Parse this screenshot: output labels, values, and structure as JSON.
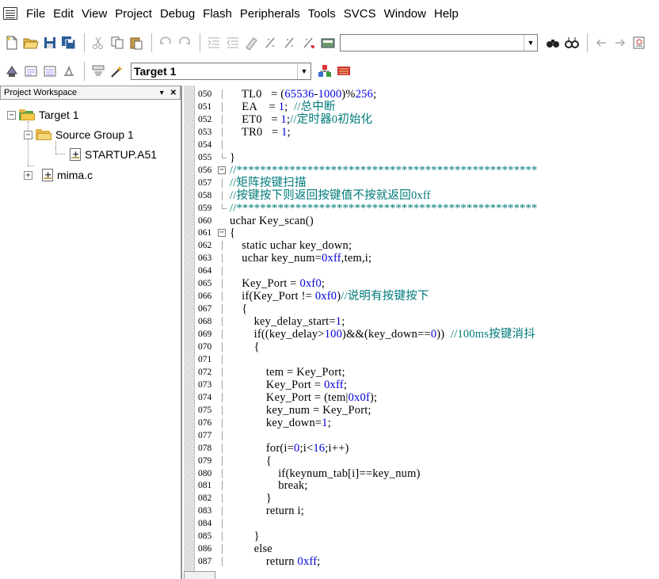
{
  "menu": [
    "File",
    "Edit",
    "View",
    "Project",
    "Debug",
    "Flash",
    "Peripherals",
    "Tools",
    "SVCS",
    "Window",
    "Help"
  ],
  "toolbar2": {
    "target_select": "Target 1"
  },
  "workspace": {
    "title": "Project Workspace",
    "tree": {
      "target": "Target 1",
      "group": "Source Group 1",
      "files": [
        "STARTUP.A51",
        "mima.c"
      ]
    }
  },
  "editor": {
    "lines": [
      {
        "n": "050",
        "text": "    TL0   = (65536-1000)%256;"
      },
      {
        "n": "051",
        "text": "    EA    = 1;  //总中断"
      },
      {
        "n": "052",
        "text": "    ET0   = 1;//定时器0初始化"
      },
      {
        "n": "053",
        "text": "    TR0   = 1;"
      },
      {
        "n": "054",
        "text": ""
      },
      {
        "n": "055",
        "text": "}"
      },
      {
        "n": "056",
        "text": "//***************************************************"
      },
      {
        "n": "057",
        "text": "//矩阵按键扫描"
      },
      {
        "n": "058",
        "text": "//按键按下则返回按键值不按就返回0xff"
      },
      {
        "n": "059",
        "text": "//***************************************************"
      },
      {
        "n": "060",
        "text": "uchar Key_scan()"
      },
      {
        "n": "061",
        "text": "{"
      },
      {
        "n": "062",
        "text": "    static uchar key_down;"
      },
      {
        "n": "063",
        "text": "    uchar key_num=0xff,tem,i;"
      },
      {
        "n": "064",
        "text": ""
      },
      {
        "n": "065",
        "text": "    Key_Port = 0xf0;"
      },
      {
        "n": "066",
        "text": "    if(Key_Port != 0xf0)//说明有按键按下"
      },
      {
        "n": "067",
        "text": "    {"
      },
      {
        "n": "068",
        "text": "        key_delay_start=1;"
      },
      {
        "n": "069",
        "text": "        if((key_delay>100)&&(key_down==0))  //100ms按键消抖"
      },
      {
        "n": "070",
        "text": "        {"
      },
      {
        "n": "071",
        "text": ""
      },
      {
        "n": "072",
        "text": "            tem = Key_Port;"
      },
      {
        "n": "073",
        "text": "            Key_Port = 0xff;"
      },
      {
        "n": "074",
        "text": "            Key_Port = (tem|0x0f);"
      },
      {
        "n": "075",
        "text": "            key_num = Key_Port;"
      },
      {
        "n": "076",
        "text": "            key_down=1;"
      },
      {
        "n": "077",
        "text": ""
      },
      {
        "n": "078",
        "text": "            for(i=0;i<16;i++)"
      },
      {
        "n": "079",
        "text": "            {"
      },
      {
        "n": "080",
        "text": "                if(keynum_tab[i]==key_num)"
      },
      {
        "n": "081",
        "text": "                break;"
      },
      {
        "n": "082",
        "text": "            }"
      },
      {
        "n": "083",
        "text": "            return i;"
      },
      {
        "n": "084",
        "text": ""
      },
      {
        "n": "085",
        "text": "        }"
      },
      {
        "n": "086",
        "text": "        else"
      },
      {
        "n": "087",
        "text": "            return 0xff;"
      }
    ]
  },
  "colors": {
    "number": "#0000d8",
    "comment": "#007a7a",
    "text": "#000000"
  }
}
